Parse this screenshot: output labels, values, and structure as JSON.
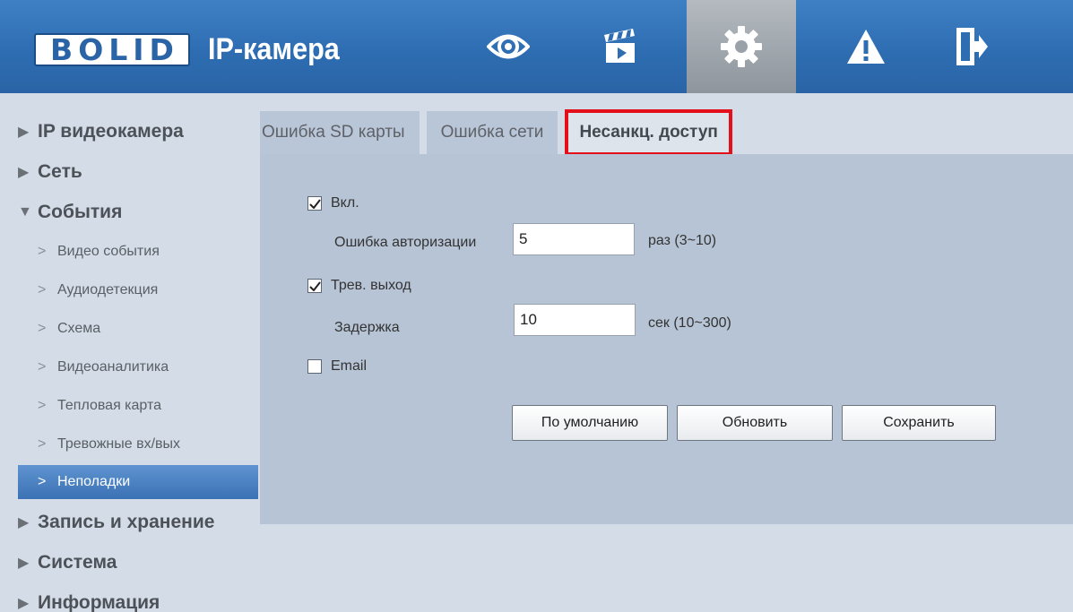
{
  "header": {
    "logo_text": "BOLID",
    "app_title": "IP-камера",
    "nav": [
      {
        "icon": "eye-icon",
        "name": "live"
      },
      {
        "icon": "clapperboard-icon",
        "name": "playback"
      },
      {
        "icon": "gear-icon",
        "name": "settings",
        "active": true
      },
      {
        "icon": "warning-icon",
        "name": "alarm"
      },
      {
        "icon": "exit-icon",
        "name": "logout"
      }
    ]
  },
  "sidebar": {
    "items": [
      {
        "label": "IP видеокамера",
        "type": "category",
        "marker": "▶"
      },
      {
        "label": "Сеть",
        "type": "category",
        "marker": "▶"
      },
      {
        "label": "События",
        "type": "category",
        "marker": "▼"
      },
      {
        "label": "Видео события",
        "type": "sub",
        "marker": ">"
      },
      {
        "label": "Аудиодетекция",
        "type": "sub",
        "marker": ">"
      },
      {
        "label": "Схема",
        "type": "sub",
        "marker": ">"
      },
      {
        "label": "Видеоаналитика",
        "type": "sub",
        "marker": ">"
      },
      {
        "label": "Тепловая карта",
        "type": "sub",
        "marker": ">"
      },
      {
        "label": "Тревожные вх/вых",
        "type": "sub",
        "marker": ">"
      },
      {
        "label": "Неполадки",
        "type": "sub",
        "marker": ">",
        "active": true
      },
      {
        "label": "Запись и хранение",
        "type": "category",
        "marker": "▶"
      },
      {
        "label": "Система",
        "type": "category",
        "marker": "▶"
      },
      {
        "label": "Информация",
        "type": "category",
        "marker": "▶"
      }
    ]
  },
  "tabs": [
    {
      "label": "Ошибка SD карты"
    },
    {
      "label": "Ошибка сети"
    },
    {
      "label": "Несанкц. доступ",
      "active": true
    }
  ],
  "form": {
    "enable": {
      "label": "Вкл.",
      "checked": true
    },
    "auth_error": {
      "label": "Ошибка авторизации",
      "value": "5",
      "unit": "раз (3~10)"
    },
    "alarm_out": {
      "label": "Трев. выход",
      "checked": true
    },
    "delay": {
      "label": "Задержка",
      "value": "10",
      "unit": "сек (10~300)"
    },
    "email": {
      "label": "Email",
      "checked": false
    }
  },
  "buttons": {
    "default_label": "По умолчанию",
    "refresh_label": "Обновить",
    "save_label": "Сохранить"
  },
  "colors": {
    "header_blue": "#2e6db2",
    "active_tab_highlight": "#e3101b",
    "sidebar_active": "#3b72b5"
  }
}
